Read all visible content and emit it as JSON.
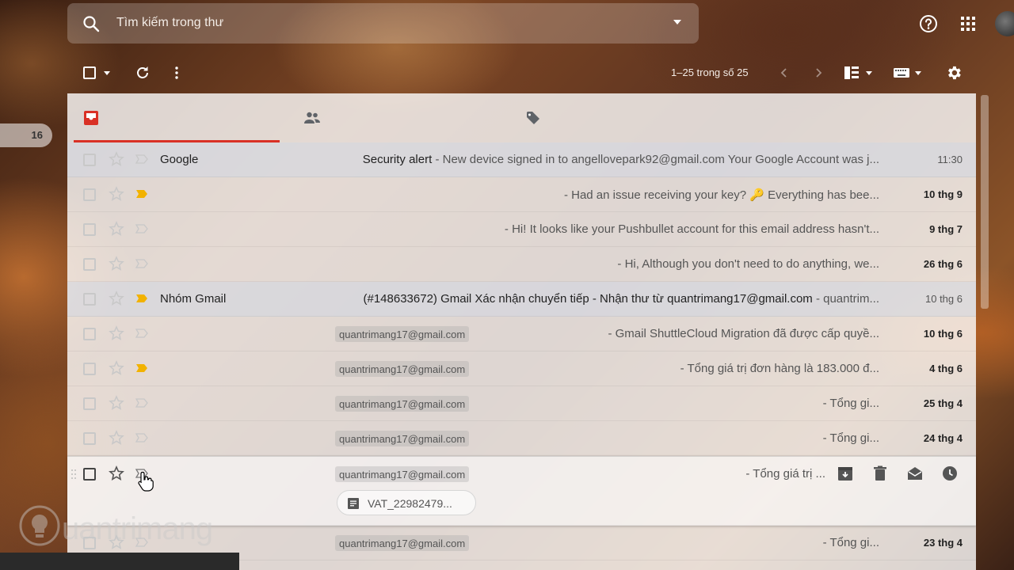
{
  "search": {
    "placeholder": "Tìm kiếm trong thư"
  },
  "toolbar": {
    "pagination": "1–25 trong số 25"
  },
  "sidebar": {
    "inbox_count": "16"
  },
  "tabs": [
    {
      "name": "primary",
      "icon": "inbox-icon",
      "active": true
    },
    {
      "name": "social",
      "icon": "people-icon",
      "active": false
    },
    {
      "name": "promotions",
      "icon": "tag-icon",
      "active": false
    }
  ],
  "emails": [
    {
      "sender": "Google",
      "subject": "Security alert",
      "snippet": " - New device signed in to angellovepark92@gmail.com Your Google Account was j...",
      "date": "11:30",
      "read": true,
      "important": false
    },
    {
      "sender": "",
      "subject": "",
      "snippet": "- Had an issue receiving your key? 🔑 Everything has bee...",
      "date": "10 thg 9",
      "read": false,
      "important": true
    },
    {
      "sender": "",
      "subject": "",
      "snippet": "- Hi! It looks like your Pushbullet account for this email address hasn't...",
      "date": "9 thg 7",
      "read": false,
      "important": false
    },
    {
      "sender": "",
      "subject": "",
      "snippet": "- Hi, Although you don't need to do anything, we...",
      "date": "26 thg 6",
      "read": false,
      "important": false
    },
    {
      "sender": "Nhóm Gmail",
      "subject": "(#148633672) Gmail Xác nhận chuyển tiếp - Nhận thư từ quantrimang17@gmail.com",
      "snippet": " - quantrim...",
      "date": "10 thg 6",
      "read": true,
      "important": true
    },
    {
      "sender": "",
      "chip": "quantrimang17@gmail.com",
      "subject": "",
      "snippet": "- Gmail ShuttleCloud Migration đã được cấp quyề...",
      "date": "10 thg 6",
      "read": false,
      "important": false
    },
    {
      "sender": "",
      "chip": "quantrimang17@gmail.com",
      "subject": "",
      "snippet": "- Tổng giá trị đơn hàng là 183.000 đ...",
      "date": "4 thg 6",
      "read": false,
      "important": true
    },
    {
      "sender": "",
      "chip": "quantrimang17@gmail.com",
      "subject": "",
      "snippet": "- Tổng gi...",
      "date": "25 thg 4",
      "read": false,
      "important": false
    },
    {
      "sender": "",
      "chip": "quantrimang17@gmail.com",
      "subject": "",
      "snippet": "- Tổng gi...",
      "date": "24 thg 4",
      "read": false,
      "important": false
    },
    {
      "sender": "",
      "chip": "quantrimang17@gmail.com",
      "subject": "",
      "snippet": "- Tổng giá trị ...",
      "date": "",
      "read": false,
      "important": false,
      "hover": true,
      "attachment": "VAT_22982479..."
    },
    {
      "sender": "",
      "chip": "quantrimang17@gmail.com",
      "subject": "",
      "snippet": "- Tổng gi...",
      "date": "23 thg 4",
      "read": false,
      "important": false
    }
  ],
  "watermark": {
    "text": "uantrimang"
  },
  "colors": {
    "accent": "#d93025",
    "important": "#f2b200"
  }
}
